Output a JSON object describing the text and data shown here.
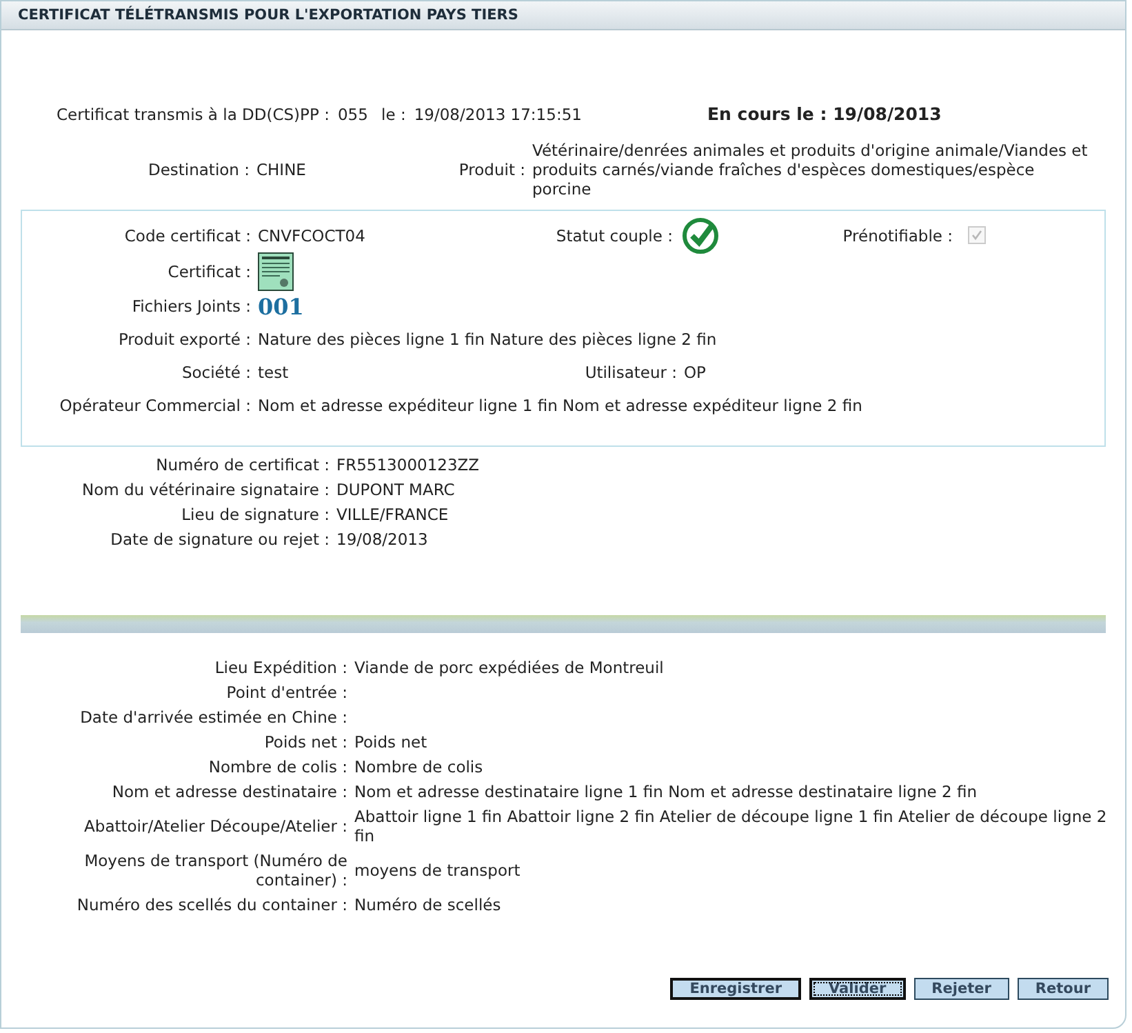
{
  "header": {
    "title": "CERTIFICAT TÉLÉTRANSMIS POUR L'EXPORTATION PAYS TIERS"
  },
  "transmission": {
    "label": "Certificat transmis à la DD(CS)PP :",
    "number": "055",
    "date_label": "le :",
    "date": "19/08/2013 17:15:51",
    "status": "En cours le : 19/08/2013"
  },
  "destination": {
    "label": "Destination :",
    "value": "CHINE"
  },
  "produit": {
    "label": "Produit :",
    "value": "Vétérinaire/denrées animales et produits d'origine animale/Viandes et produits carnés/viande fraîches d'espèces domestiques/espèce porcine"
  },
  "certificate_box": {
    "code": {
      "label": "Code certificat :",
      "value": "CNVFCOCT04"
    },
    "statut_couple": {
      "label": "Statut couple :",
      "ok": true
    },
    "prenotifiable": {
      "label": "Prénotifiable :",
      "checked": true,
      "disabled": true
    },
    "certificat": {
      "label": "Certificat :"
    },
    "fichiers_joints": {
      "label": "Fichiers Joints :",
      "value": "001"
    },
    "produit_exporte": {
      "label": "Produit exporté :",
      "value": "Nature des pièces ligne 1 fin Nature des pièces ligne 2 fin"
    },
    "societe": {
      "label": "Société :",
      "value": "test"
    },
    "utilisateur": {
      "label": "Utilisateur :",
      "value": "OP"
    },
    "operateur": {
      "label": "Opérateur Commercial :",
      "value": "Nom et adresse expéditeur ligne 1 fin Nom et adresse expéditeur ligne 2 fin"
    }
  },
  "signature": [
    {
      "label": "Numéro de certificat :",
      "value": "FR5513000123ZZ"
    },
    {
      "label": "Nom du vétérinaire signataire :",
      "value": "DUPONT MARC"
    },
    {
      "label": "Lieu de signature :",
      "value": "VILLE/FRANCE"
    },
    {
      "label": "Date de signature ou rejet :",
      "value": "19/08/2013"
    }
  ],
  "shipment": [
    {
      "label": "Lieu Expédition :",
      "value": "Viande de porc expédiées de Montreuil"
    },
    {
      "label": "Point d'entrée :"
    },
    {
      "label": "Date d'arrivée estimée en Chine :"
    },
    {
      "label": "Poids net :",
      "value": "Poids net"
    },
    {
      "label": "Nombre de colis :",
      "value": "Nombre de colis"
    },
    {
      "label": "Nom et adresse destinataire :",
      "value": "Nom et adresse destinataire ligne 1 fin Nom et adresse destinataire ligne 2 fin"
    },
    {
      "label": "Abattoir/Atelier Découpe/Atelier :",
      "value": "Abattoir ligne 1 fin Abattoir ligne 2 fin Atelier de découpe ligne 1 fin Atelier de découpe ligne 2 fin"
    },
    {
      "label": "Moyens de transport (Numéro de container) :",
      "value": "moyens de transport"
    },
    {
      "label": "Numéro des scellés du container :",
      "value": "Numéro de scellés"
    }
  ],
  "buttons": [
    {
      "label": "Enregistrer",
      "emphasized": true,
      "focused": false
    },
    {
      "label": "Valider",
      "emphasized": true,
      "focused": true
    },
    {
      "label": "Rejeter",
      "emphasized": false,
      "focused": false
    },
    {
      "label": "Retour",
      "emphasized": false,
      "focused": false
    }
  ]
}
